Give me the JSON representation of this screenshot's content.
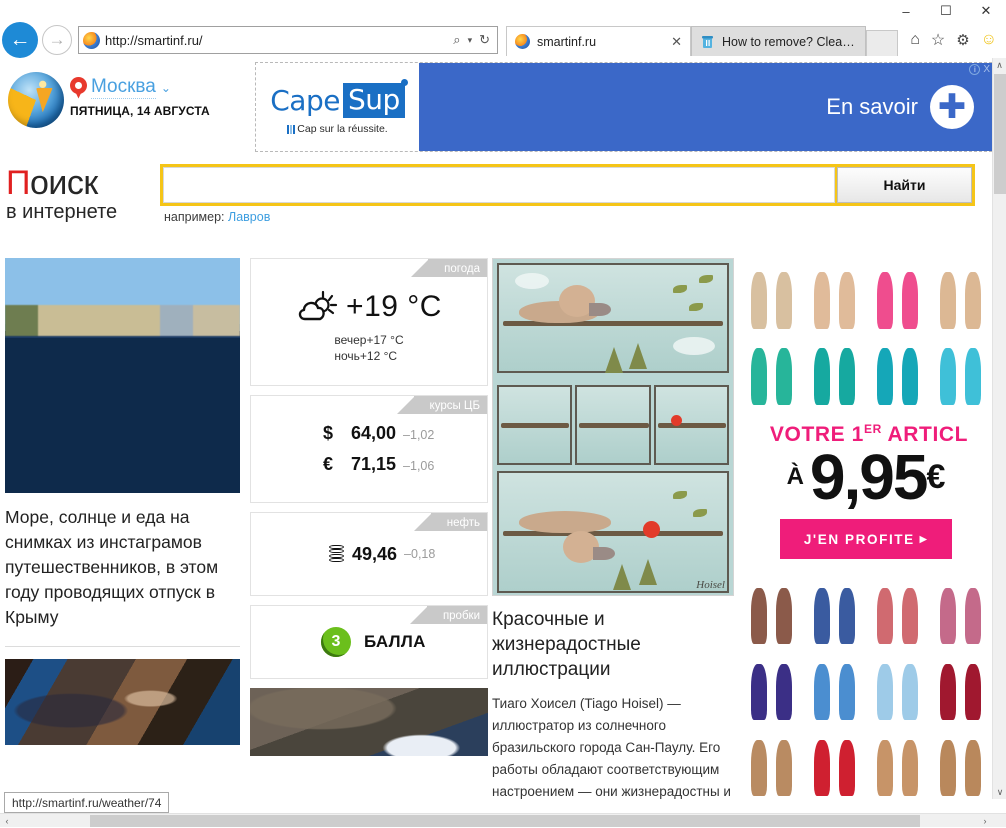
{
  "browser": {
    "window_controls": {
      "minimize": "–",
      "maximize": "☐",
      "close": "✕"
    },
    "back_icon": "←",
    "forward_icon": "→",
    "address_value": "http://smartinf.ru/",
    "address_search_icon": "⌕",
    "address_caret_icon": "▾",
    "address_refresh_icon": "↻",
    "tabs": [
      {
        "label": "smartinf.ru",
        "close": "✕",
        "active": true
      },
      {
        "label": "How to remove? Clean you...",
        "active": false
      }
    ],
    "tools": {
      "home": "⌂",
      "favorites": "☆",
      "settings": "⚙",
      "smiley": "☺"
    },
    "status_url": "http://smartinf.ru/weather/74"
  },
  "site": {
    "city": "Москва",
    "city_caret": "⌄",
    "date": "ПЯТНИЦА, 14 АВГУСТА",
    "search": {
      "title_first_letter": "П",
      "title_rest": "оиск",
      "subtitle": "в интернете",
      "input_value": "",
      "input_placeholder": "",
      "button_label": "Найти",
      "example_label": "например:",
      "example_link": "Лавров"
    }
  },
  "top_ad": {
    "brand_part1": "Cape",
    "brand_part2": "Sup",
    "tagline": "Cap sur la réussite.",
    "cta": "En savoir",
    "plus_icon": "✚",
    "info_icon": "i",
    "close_icon": "X"
  },
  "left_column": {
    "photo_name": "sea-crimea-photo",
    "headline": "Море, солнце и еда на снимках из инстаграмов путешественников, в этом году проводящих отпуск в Крыму"
  },
  "widgets": {
    "weather": {
      "tab": "погода",
      "temp": "+19 °C",
      "evening": "вечер+17 °C",
      "night": "ночь+12 °C"
    },
    "rates": {
      "tab": "курсы ЦБ",
      "rows": [
        {
          "symbol": "$",
          "value": "64,00",
          "delta": "–1,02"
        },
        {
          "symbol": "€",
          "value": "71,15",
          "delta": "–1,06"
        }
      ]
    },
    "oil": {
      "tab": "нефть",
      "value": "49,46",
      "delta": "–0,18"
    },
    "traffic": {
      "tab": "пробки",
      "score": "3",
      "label": "БАЛЛА"
    }
  },
  "article": {
    "illustration_signature": "Hoisel",
    "title": "Красочные и жизнерадостные иллюстрации",
    "body": "Тиаго Хоисел (Tiago Hoisel) — иллюстратор из солнечного бразильского города Сан-Паулу. Его работы обладают соответствующим настроением — они жизнерадостны и"
  },
  "right_ad": {
    "headline": "VOTRE 1",
    "headline_sup": "ER",
    "headline_tail": " ARTICL",
    "price_prefix": "À",
    "price_number": "9,95",
    "price_currency": "€",
    "button_label": "J'EN PROFITE",
    "button_arrow": "▸"
  },
  "scrollbars": {
    "v_up": "∧",
    "v_down": "∨",
    "h_left": "‹",
    "h_right": "›"
  },
  "colors": {
    "accent_yellow": "#f5c518",
    "brand_blue": "#3b68c8",
    "ad_pink": "#ef1d7a",
    "link_blue": "#3d9ee0",
    "traffic_green": "#6bbf1c"
  }
}
